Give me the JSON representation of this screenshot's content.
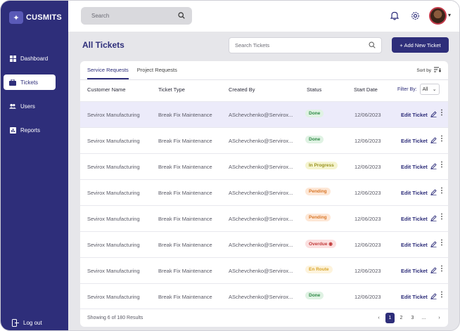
{
  "app": {
    "name": "CUSMITS"
  },
  "sidebar": {
    "items": [
      {
        "label": "Dashboard",
        "icon": "grid-icon",
        "active": false
      },
      {
        "label": "Tickets",
        "icon": "briefcase-icon",
        "active": true
      },
      {
        "label": "Users",
        "icon": "users-icon",
        "active": false
      },
      {
        "label": "Reports",
        "icon": "chart-icon",
        "active": false
      }
    ],
    "logout": "Log out"
  },
  "topbar": {
    "search_placeholder": "Search"
  },
  "main": {
    "title": "All Tickets",
    "search_placeholder": "Search Tickets",
    "add_button": "+ Add New Ticket"
  },
  "tabs": [
    {
      "label": "Service Requests",
      "active": true
    },
    {
      "label": "Project Requests",
      "active": false
    }
  ],
  "sort_label": "Sort by",
  "table": {
    "headers": {
      "customer": "Customer Name",
      "type": "Ticket Type",
      "created": "Created By",
      "status": "Status",
      "start": "Start Date"
    },
    "filter_label": "Filter By:",
    "filter_value": "All",
    "edit_label": "Edit Ticket",
    "rows": [
      {
        "customer": "Sevirox Manufacturing",
        "type": "Break Fix Maintenance",
        "created": "ASchevchenko@Servirox...",
        "status": "Done",
        "start": "12/06/2023"
      },
      {
        "customer": "Sevirox Manufacturing",
        "type": "Break Fix Maintenance",
        "created": "ASchevchenko@Servirox...",
        "status": "Done",
        "start": "12/06/2023"
      },
      {
        "customer": "Sevirox Manufacturing",
        "type": "Break Fix Maintenance",
        "created": "ASchevchenko@Servirox...",
        "status": "In Progress",
        "start": "12/06/2023"
      },
      {
        "customer": "Sevirox Manufacturing",
        "type": "Break Fix Maintenance",
        "created": "ASchevchenko@Servirox...",
        "status": "Pending",
        "start": "12/06/2023"
      },
      {
        "customer": "Sevirox Manufacturing",
        "type": "Break Fix Maintenance",
        "created": "ASchevchenko@Servirox...",
        "status": "Pending",
        "start": "12/06/2023"
      },
      {
        "customer": "Sevirox Manufacturing",
        "type": "Break Fix Maintenance",
        "created": "ASchevchenko@Servirox...",
        "status": "Overdue",
        "start": "12/06/2023"
      },
      {
        "customer": "Sevirox Manufacturing",
        "type": "Break Fix Maintenance",
        "created": "ASchevchenko@Servirox...",
        "status": "En Route",
        "start": "12/06/2023"
      },
      {
        "customer": "Sevirox Manufacturing",
        "type": "Break Fix Maintenance",
        "created": "ASchevchenko@Servirox...",
        "status": "Done",
        "start": "12/06/2023"
      }
    ]
  },
  "footer": {
    "showing": "Showing 6 of 180 Results",
    "pages": [
      "1",
      "2",
      "3",
      "..."
    ],
    "current_page": "1"
  },
  "colors": {
    "primary": "#2e2e7a",
    "done_bg": "#dff2e3",
    "done_fg": "#2f8a47",
    "progress_bg": "#f5f4cf",
    "progress_fg": "#9a9420",
    "pending_bg": "#fde7d6",
    "pending_fg": "#d9782a",
    "overdue_bg": "#fbe0e0",
    "overdue_fg": "#c23a3a",
    "enroute_bg": "#fdf3dc",
    "enroute_fg": "#d9a52a"
  }
}
